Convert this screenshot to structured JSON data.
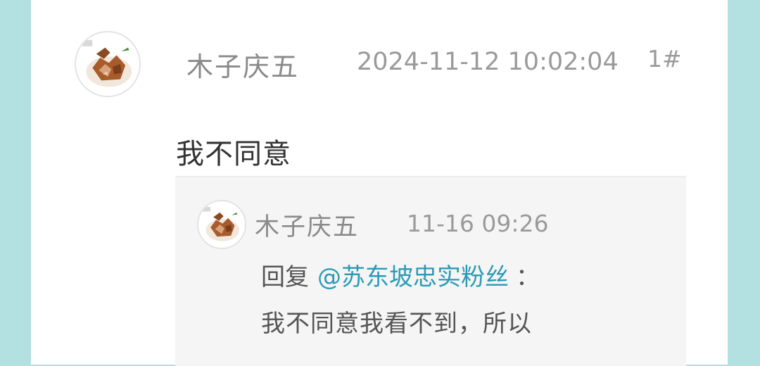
{
  "comment": {
    "author": "木子庆五",
    "timestamp": "2024-11-12 10:02:04",
    "floor": "1#",
    "text": "我不同意",
    "avatar_icon": "food-dish-avatar"
  },
  "reply": {
    "author": "木子庆五",
    "timestamp": "11-16 09:26",
    "prefix": "回复",
    "mention": "@苏东坡忠实粉丝",
    "colon": "：",
    "text": "我不同意我看不到，所以",
    "avatar_icon": "food-dish-avatar"
  },
  "colors": {
    "background": "#b3e0e0",
    "mention": "#2a9bb5",
    "reply_bg": "#f5f5f5"
  }
}
